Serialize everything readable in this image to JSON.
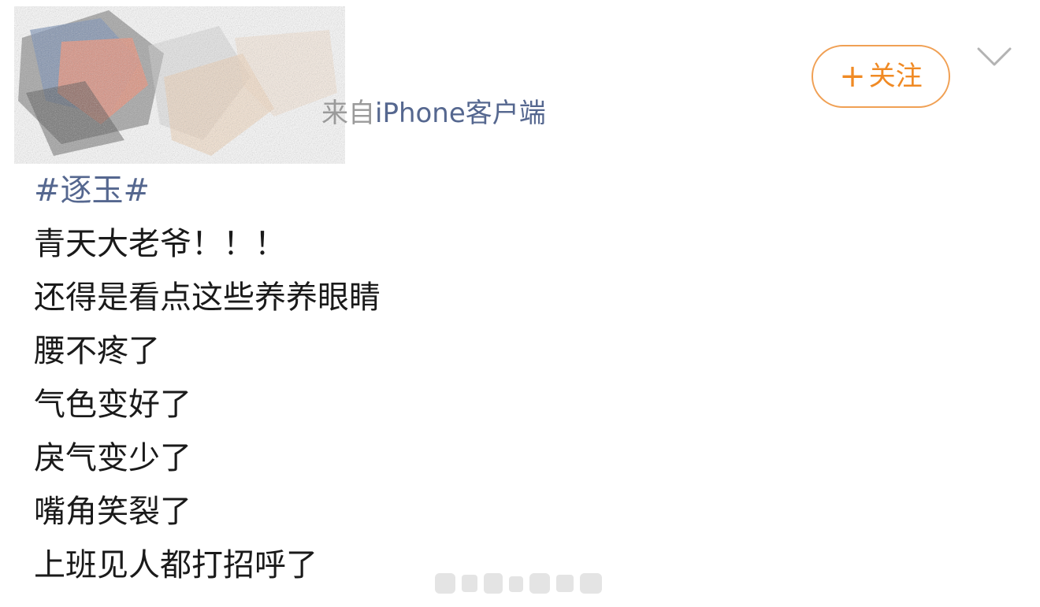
{
  "post": {
    "source_prefix": "来自",
    "source_client": "iPhone客户端",
    "follow_plus": "+",
    "follow_label": "关注",
    "hashtag": "#逐玉#",
    "lines": [
      "青天大老爷！！！",
      "还得是看点这些养养眼睛",
      "腰不疼了",
      "气色变好了",
      "戾气变少了",
      "嘴角笑裂了",
      "上班见人都打招呼了"
    ]
  },
  "icons": {
    "more": "chevron-down-icon"
  },
  "colors": {
    "accent_orange": "#f08a24",
    "link_blue": "#55678f",
    "text": "#1a1a1a",
    "muted": "#9a9a9a"
  }
}
